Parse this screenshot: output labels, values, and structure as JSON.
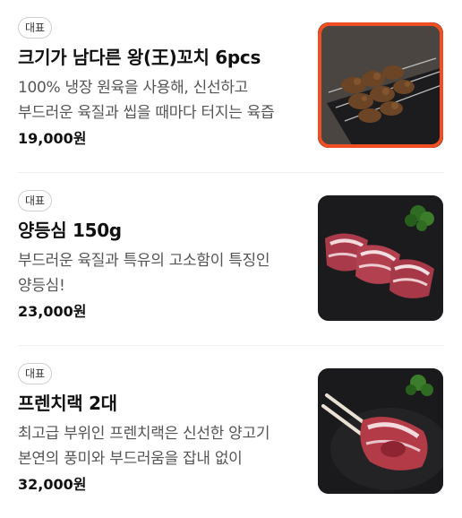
{
  "menu": {
    "items": [
      {
        "badge": "대표",
        "name": "크기가 남다른 왕(王)꼬치 6pcs",
        "description": "100% 냉장 원육을 사용해, 신선하고 부드러운 육질과 씹을 때마다 터지는 육즙",
        "price": "19,000원",
        "image_icon": "skewer-photo",
        "selected": true
      },
      {
        "badge": "대표",
        "name": "양등심 150g",
        "description": "부드러운 육질과 특유의 고소함이 특징인 양등심!",
        "price": "23,000원",
        "image_icon": "lamb-loin-photo",
        "selected": false
      },
      {
        "badge": "대표",
        "name": "프렌치랙 2대",
        "description": "최고급 부위인 프렌치랙은 신선한 양고기 본연의 풍미와 부드러움을 잡내 없이",
        "price": "32,000원",
        "image_icon": "french-rack-photo",
        "selected": false
      }
    ],
    "colors": {
      "selected_border": "#f04e23",
      "badge_border": "#cfcfcf",
      "divider": "#efefef"
    }
  }
}
